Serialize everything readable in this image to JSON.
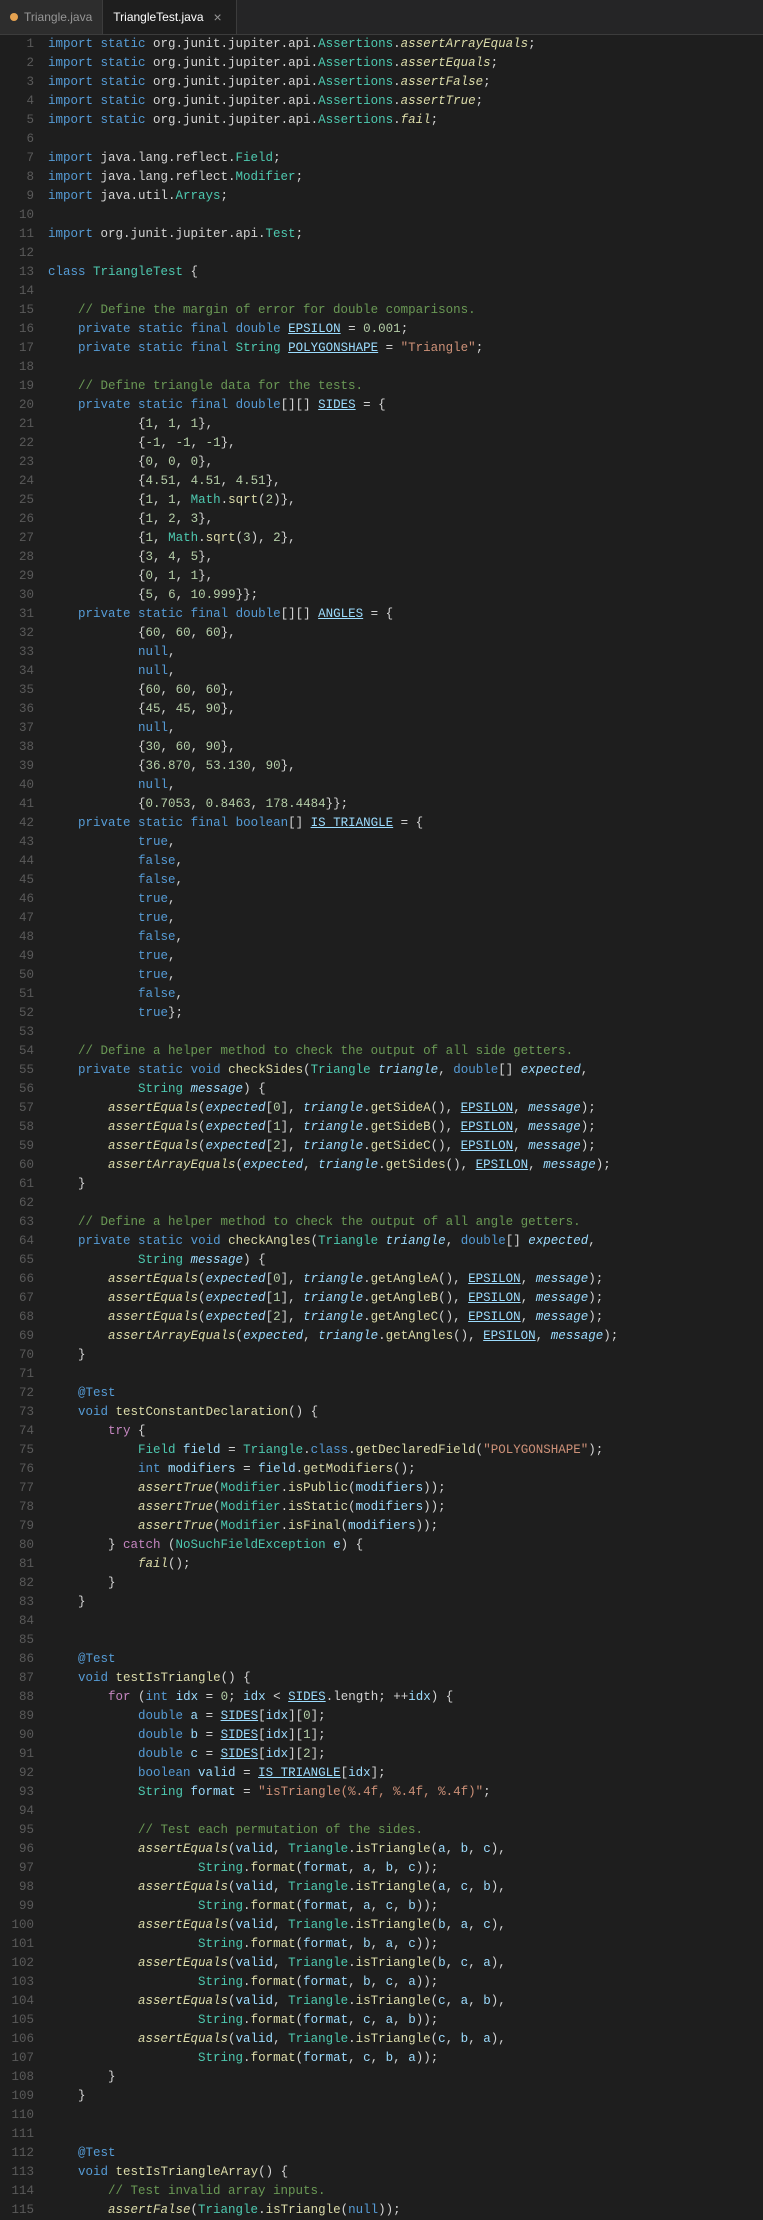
{
  "tabs": [
    {
      "id": "triangle",
      "label": "Triangle.java",
      "active": false,
      "dot": true,
      "dotColor": "orange",
      "closable": false
    },
    {
      "id": "triangletest",
      "label": "TriangleTest.java",
      "active": true,
      "dot": false,
      "dotColor": "",
      "closable": true
    }
  ],
  "title": "TriangleTest.java",
  "accent": "#007acc"
}
